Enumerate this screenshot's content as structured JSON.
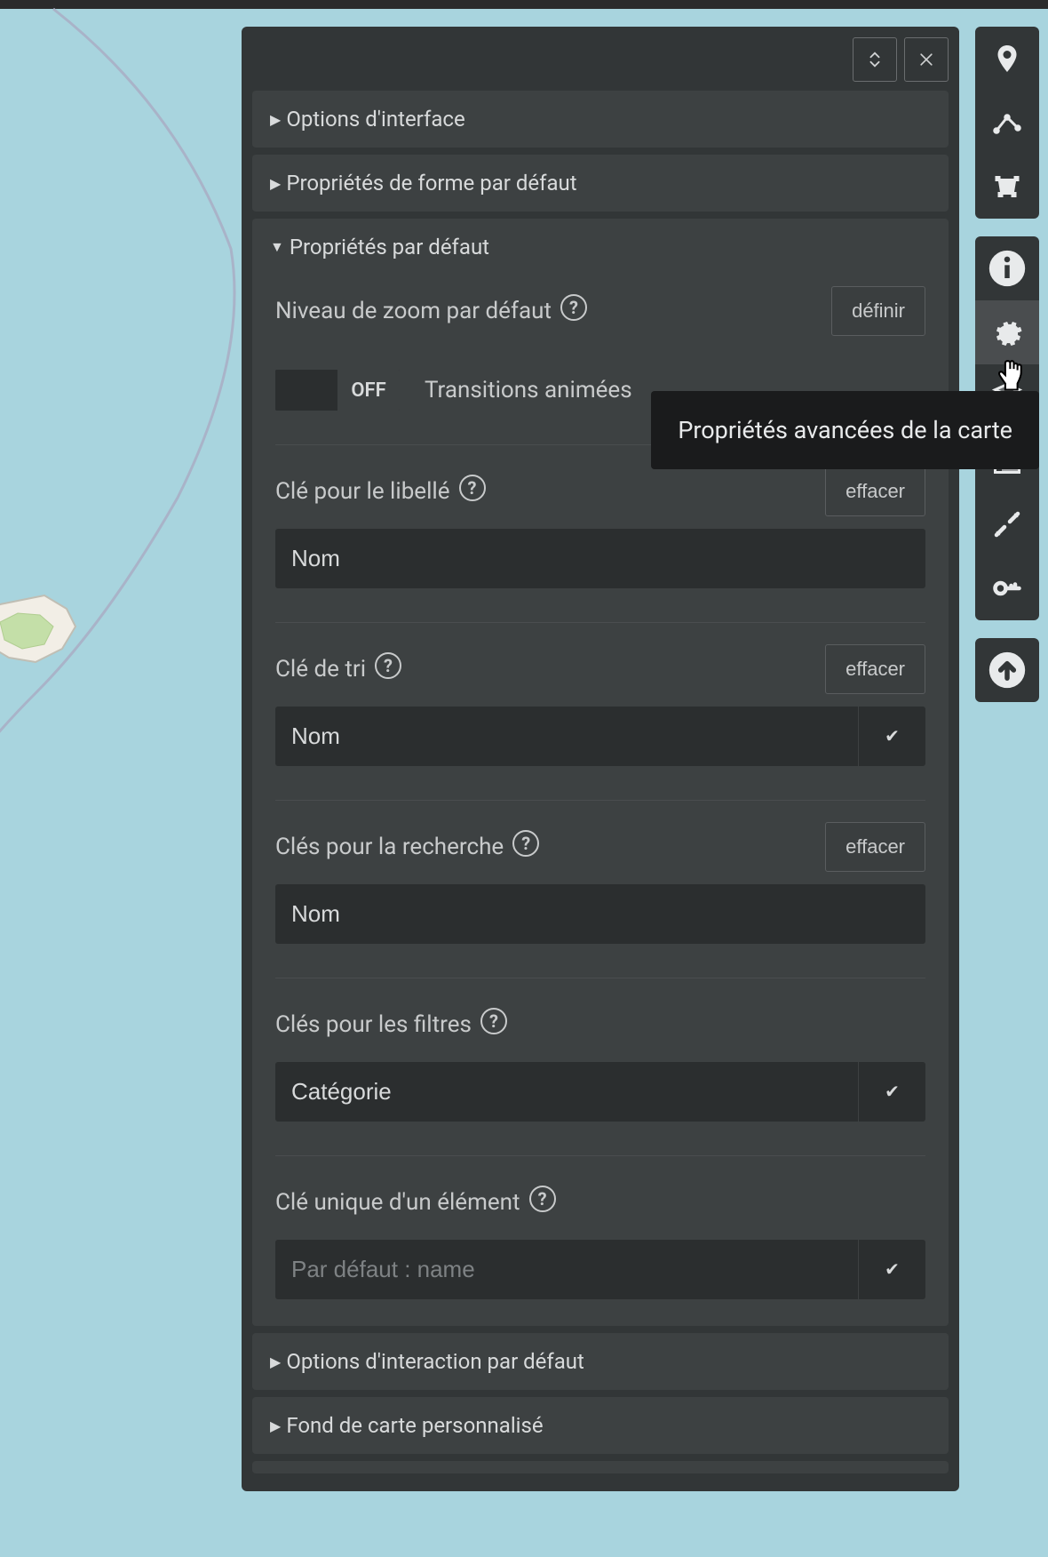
{
  "tooltip": "Propriétés avancées de la carte",
  "panel": {
    "sections": {
      "interface_options": "Options d'interface",
      "shape_defaults": "Propriétés de forme par défaut",
      "default_properties": "Propriétés par défaut",
      "interaction_defaults": "Options d'interaction par défaut",
      "custom_basemap": "Fond de carte personnalisé"
    }
  },
  "form": {
    "zoom": {
      "label": "Niveau de zoom par défaut",
      "button": "définir"
    },
    "transitions": {
      "label": "Transitions animées",
      "toggle_off": "OFF"
    },
    "label_key": {
      "label": "Clé pour le libellé",
      "button": "effacer",
      "value": "Nom"
    },
    "sort_key": {
      "label": "Clé de tri",
      "button": "effacer",
      "value": "Nom"
    },
    "search_keys": {
      "label": "Clés pour la recherche",
      "button": "effacer",
      "value": "Nom"
    },
    "filter_keys": {
      "label": "Clés pour les filtres",
      "value": "Catégorie"
    },
    "unique_key": {
      "label": "Clé unique d'un élément",
      "placeholder": "Par défaut : name"
    }
  },
  "icons": {
    "expand": "expand-collapse-icon",
    "close": "close-icon",
    "marker": "marker-icon",
    "line": "line-icon",
    "polygon": "polygon-icon",
    "info": "info-icon",
    "gear": "gear-icon",
    "layers": "layers-icon",
    "tiles": "tiles-icon",
    "center": "center-icon",
    "key": "key-icon",
    "upload": "upload-icon"
  },
  "check": "✔"
}
